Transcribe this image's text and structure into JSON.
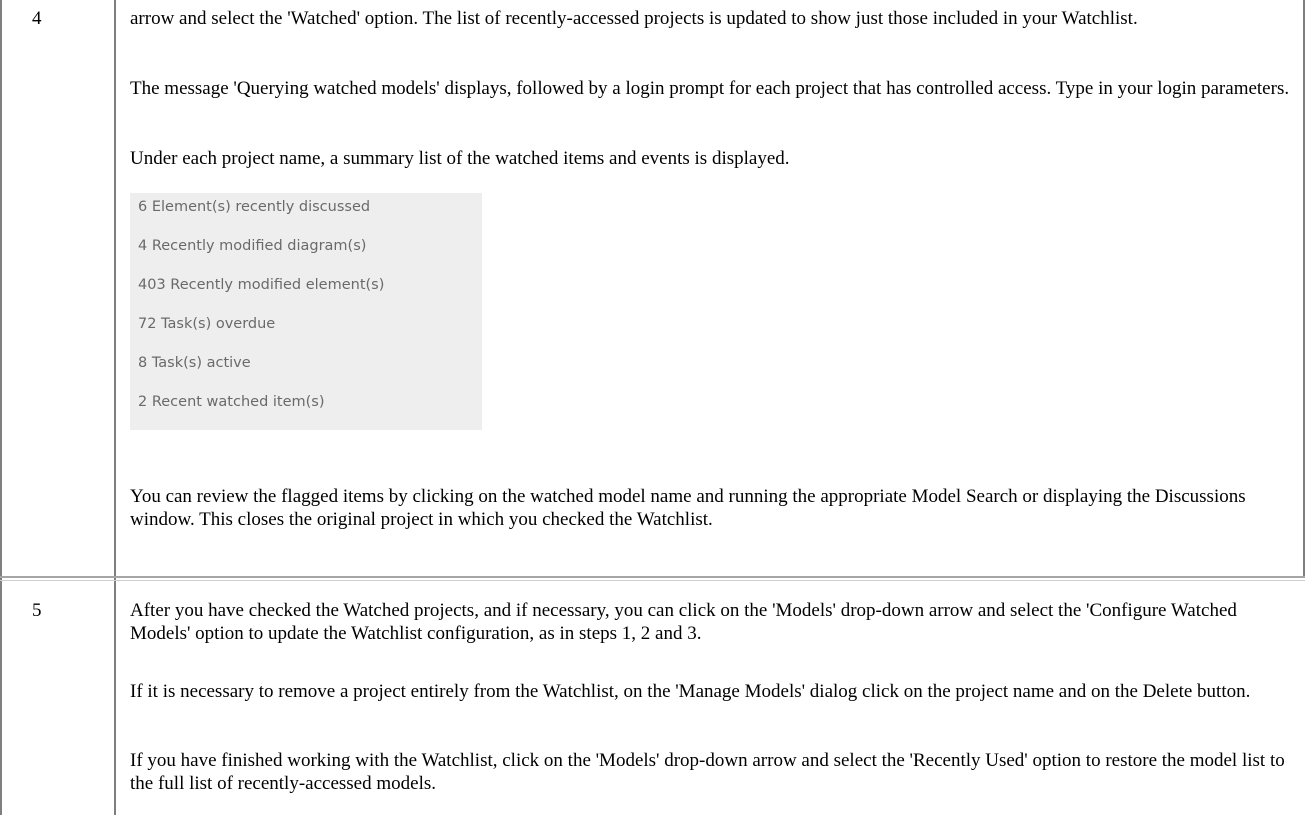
{
  "rows": [
    {
      "step": "4",
      "paragraphs": [
        "arrow and select the 'Watched' option. The list of recently-accessed projects is updated to show just those included in your Watchlist.",
        "The message 'Querying watched models' displays, followed by a login prompt for each project that has controlled access. Type in your login parameters.",
        "Under each project name, a summary list of the watched items and events is displayed."
      ],
      "summary_items": [
        "6 Element(s) recently discussed",
        "4 Recently modified diagram(s)",
        "403 Recently modified element(s)",
        "72 Task(s) overdue",
        "8 Task(s) active",
        "2 Recent watched item(s)"
      ],
      "closing_paragraph": "You can review the flagged items by clicking on the watched model name and running the appropriate Model Search or displaying the Discussions window. This closes the original project in which you checked the Watchlist."
    },
    {
      "step": "5",
      "paragraphs": [
        "After you have checked the Watched projects, and if necessary, you can click on the 'Models' drop-down arrow and select the 'Configure Watched Models' option to update the Watchlist configuration, as in steps 1, 2 and 3.",
        "If it is necessary to remove a project entirely from the Watchlist, on the 'Manage Models' dialog click on the project name and on the Delete button.",
        "If you have finished working with the Watchlist, click on the 'Models' drop-down arrow and select the 'Recently Used' option to restore the model list to the full list of recently-accessed models."
      ]
    }
  ]
}
